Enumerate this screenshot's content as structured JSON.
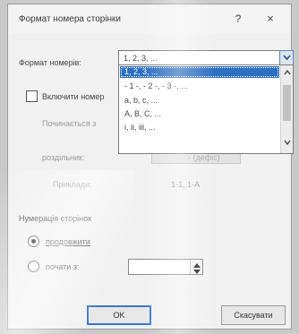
{
  "dialog": {
    "title": "Формат номера сторінки",
    "help": "?",
    "close": "×"
  },
  "format": {
    "label": "Формат номерів:",
    "value": "1, 2, 3, ...",
    "options": [
      "1, 2, 3, ...",
      "- 1 -, - 2 -, - 3 -, ...",
      "a, b, c, ...",
      "A, B, C, ...",
      "i, ii, iii, ..."
    ],
    "selected_index": 0
  },
  "chapter": {
    "checkbox_label": "Включити номер",
    "starts_with_label": "Починається з",
    "separator_label": "роздільник:",
    "separator_value": "- (дефіс)",
    "examples_label": "Приклади:",
    "examples_value": "1-1, 1-A"
  },
  "numbering": {
    "section_label": "Нумерація сторінок",
    "continue_label": "продовжити",
    "start_at_label": "почати з:",
    "start_at_value": ""
  },
  "buttons": {
    "ok": "OK",
    "cancel": "Скасувати"
  }
}
